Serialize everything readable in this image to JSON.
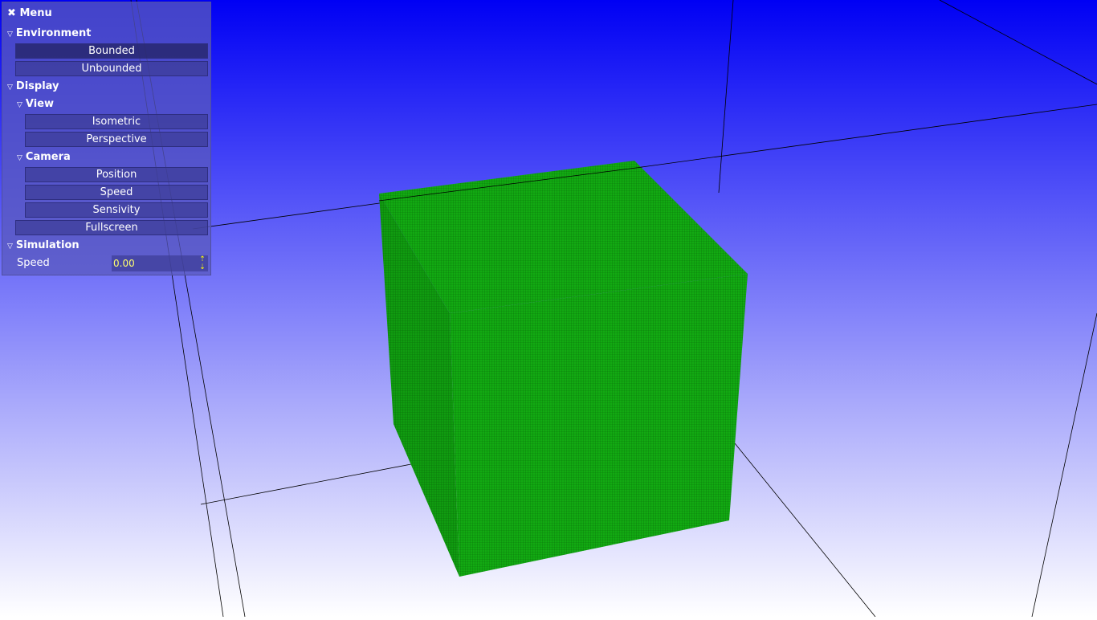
{
  "menu": {
    "title": "Menu",
    "close_icon": "close-x",
    "environment": {
      "label": "Environment",
      "buttons": [
        "Bounded",
        "Unbounded"
      ],
      "active": "Bounded"
    },
    "display": {
      "label": "Display",
      "view": {
        "label": "View",
        "buttons": [
          "Isometric",
          "Perspective"
        ]
      },
      "camera": {
        "label": "Camera",
        "buttons": [
          "Position",
          "Speed",
          "Sensivity"
        ]
      },
      "fullscreen": "Fullscreen"
    },
    "simulation": {
      "label": "Simulation",
      "speed_label": "Speed",
      "speed_value": "0.00"
    }
  },
  "colors": {
    "cube": "#11a811",
    "sky_top": "#0000f4",
    "sky_bottom": "#ffffff",
    "value_text": "#ffff70"
  }
}
